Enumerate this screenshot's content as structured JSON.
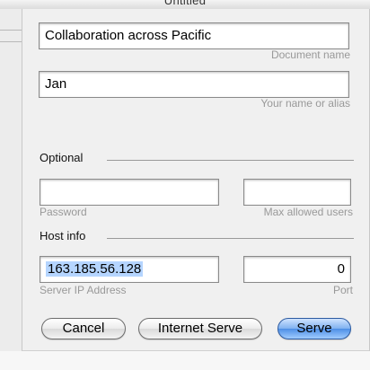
{
  "window": {
    "title": "Untitled"
  },
  "document_name": {
    "value": "Collaboration across Pacific",
    "hint": "Document name"
  },
  "user_name": {
    "value": "Jan",
    "hint": "Your name or alias"
  },
  "optional": {
    "label": "Optional",
    "password": {
      "value": "",
      "hint": "Password"
    },
    "max_users": {
      "value": "",
      "hint": "Max allowed users"
    }
  },
  "host_info": {
    "label": "Host info",
    "server_ip": {
      "value": "163.185.56.128",
      "hint": "Server IP Address"
    },
    "port": {
      "value": "0",
      "hint": "Port"
    }
  },
  "buttons": {
    "cancel": "Cancel",
    "internet_serve": "Internet Serve",
    "serve": "Serve"
  }
}
